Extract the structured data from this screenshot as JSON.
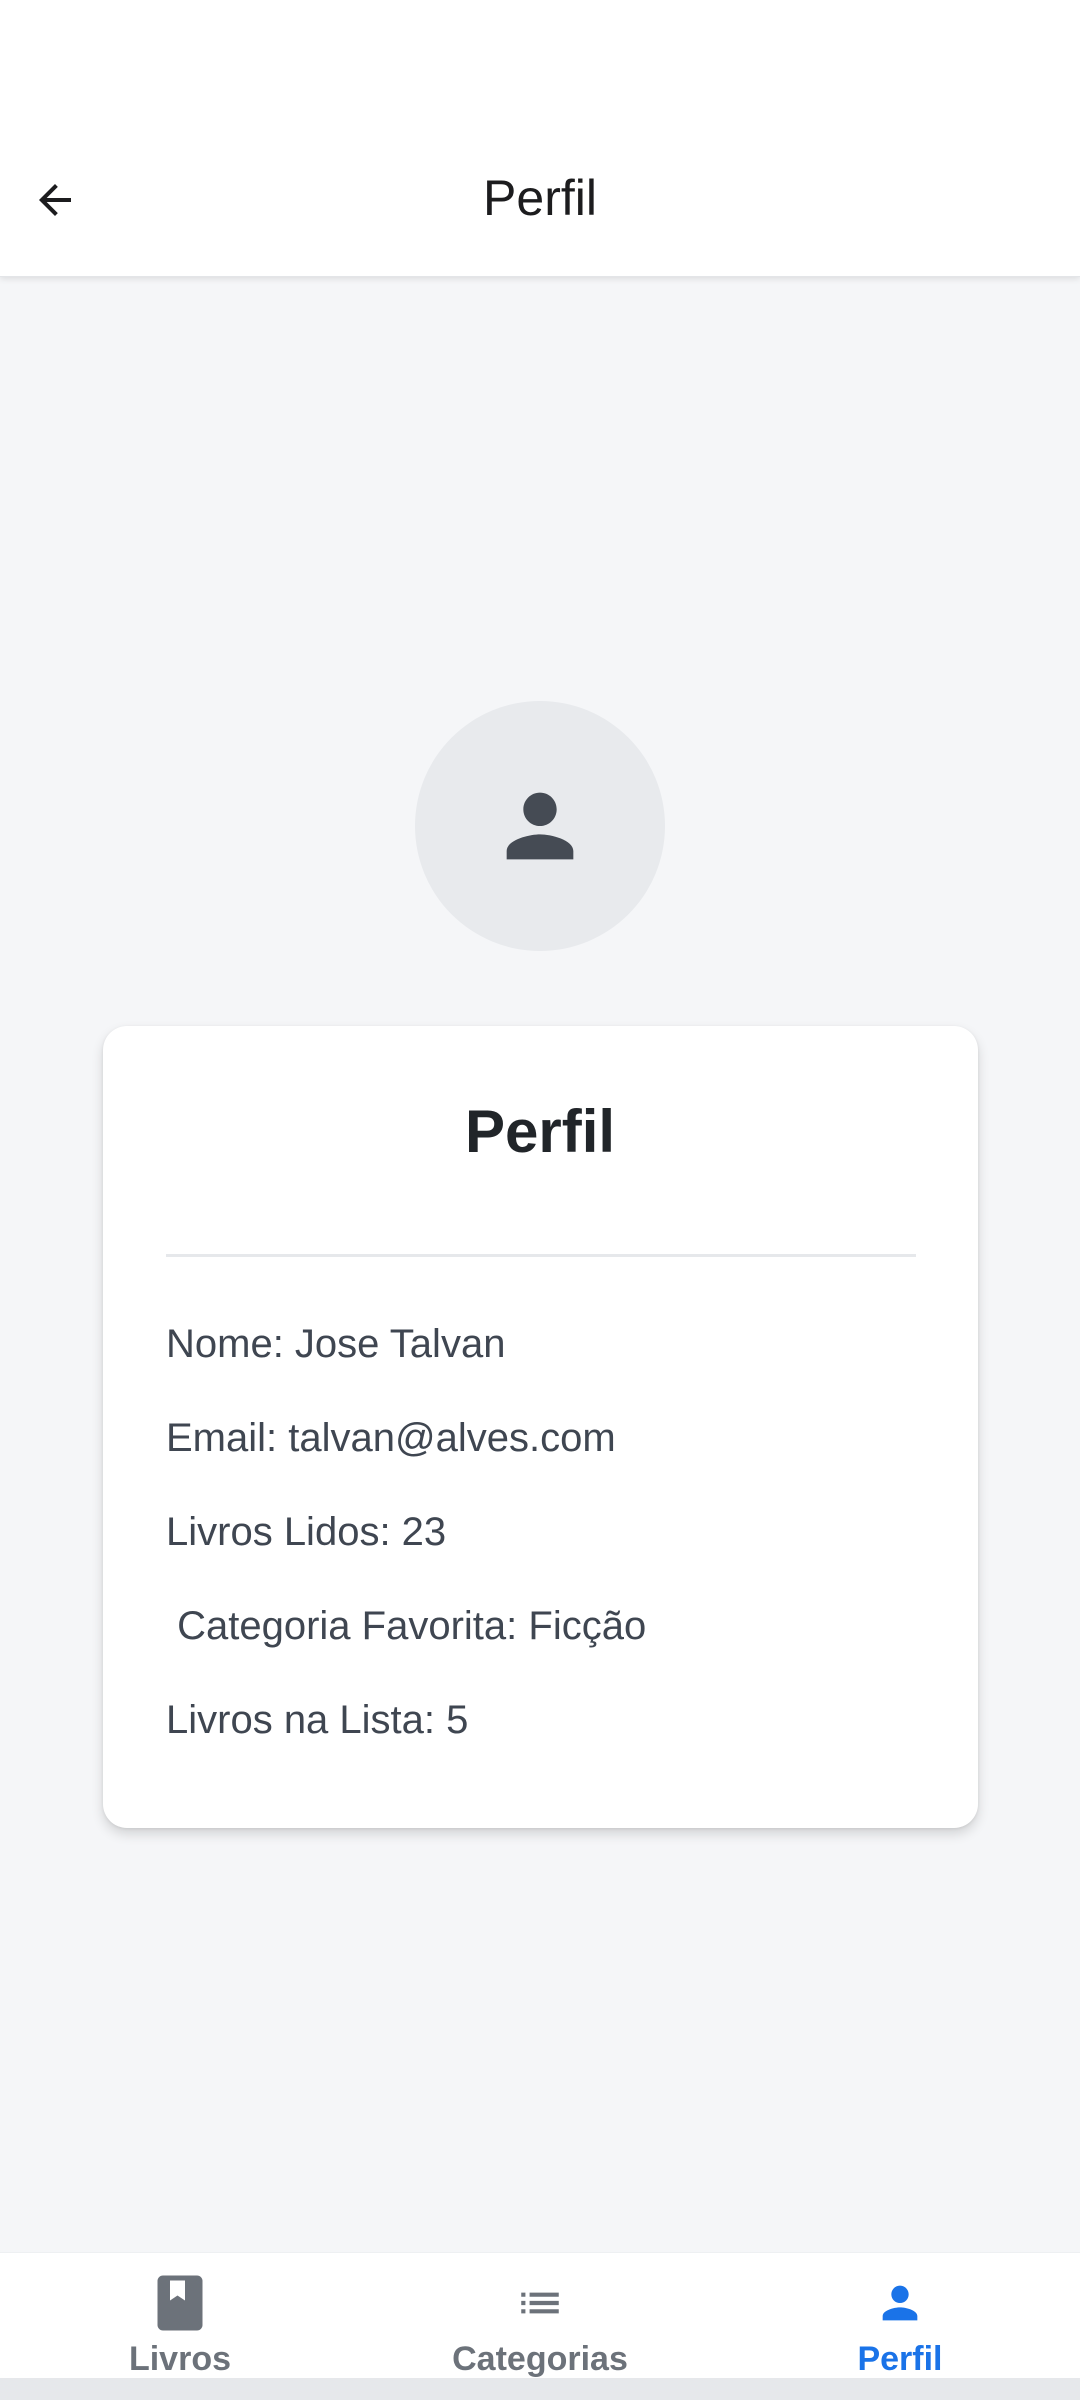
{
  "header": {
    "title": "Perfil",
    "back_icon": "arrow-left-icon"
  },
  "avatar": {
    "icon": "person-icon",
    "bg_color": "#e8eaed",
    "icon_color": "#454b54"
  },
  "profile_card": {
    "title": "Perfil",
    "fields": [
      {
        "text": "Nome: Jose Talvan"
      },
      {
        "text": "Email: talvan@alves.com"
      },
      {
        "text": "Livros Lidos: 23"
      },
      {
        "text": " Categoria Favorita: Ficção"
      },
      {
        "text": "Livros na Lista: 5"
      }
    ]
  },
  "bottom_nav": {
    "items": [
      {
        "label": "Livros",
        "icon": "book-icon",
        "active": false
      },
      {
        "label": "Categorias",
        "icon": "list-icon",
        "active": false
      },
      {
        "label": "Perfil",
        "icon": "person-icon",
        "active": true
      }
    ],
    "active_color": "#1a73e8",
    "inactive_color": "#6c727a"
  }
}
